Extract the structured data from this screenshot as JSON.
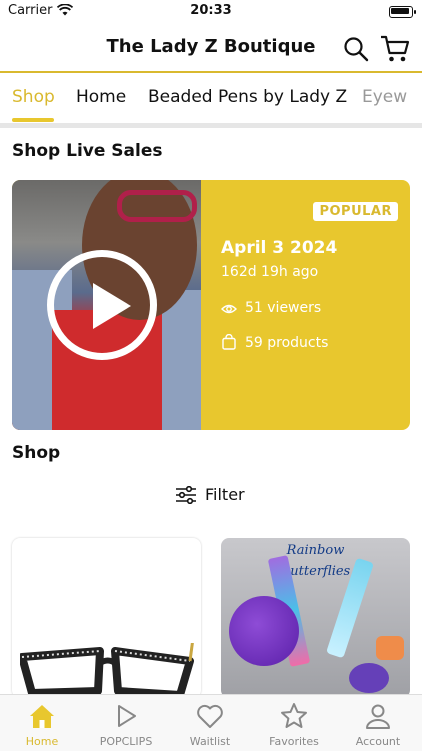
{
  "status": {
    "carrier": "Carrier",
    "time": "20:33"
  },
  "header": {
    "title": "The Lady Z Boutique"
  },
  "tabs": [
    "Shop",
    "Home",
    "Beaded Pens by Lady Z",
    "Eyew"
  ],
  "live_section": {
    "title": "Shop Live Sales",
    "badge": "POPULAR",
    "date": "April 3 2024",
    "countdown": "162d 19h ago",
    "viewers": "51 viewers",
    "products": "59 products"
  },
  "shop_section": {
    "title": "Shop",
    "filter_label": "Filter",
    "product2_title_line1": "Rainbow",
    "product2_title_line2": "Butterflies"
  },
  "bottom_nav": [
    {
      "label": "Home",
      "icon": "home-icon",
      "active": true
    },
    {
      "label": "POPCLIPS",
      "icon": "play-icon",
      "active": false
    },
    {
      "label": "Waitlist",
      "icon": "heart-icon",
      "active": false
    },
    {
      "label": "Favorites",
      "icon": "star-icon",
      "active": false
    },
    {
      "label": "Account",
      "icon": "person-icon",
      "active": false
    }
  ],
  "colors": {
    "accent": "#e8c72e",
    "accent_text": "#d9b92f"
  }
}
